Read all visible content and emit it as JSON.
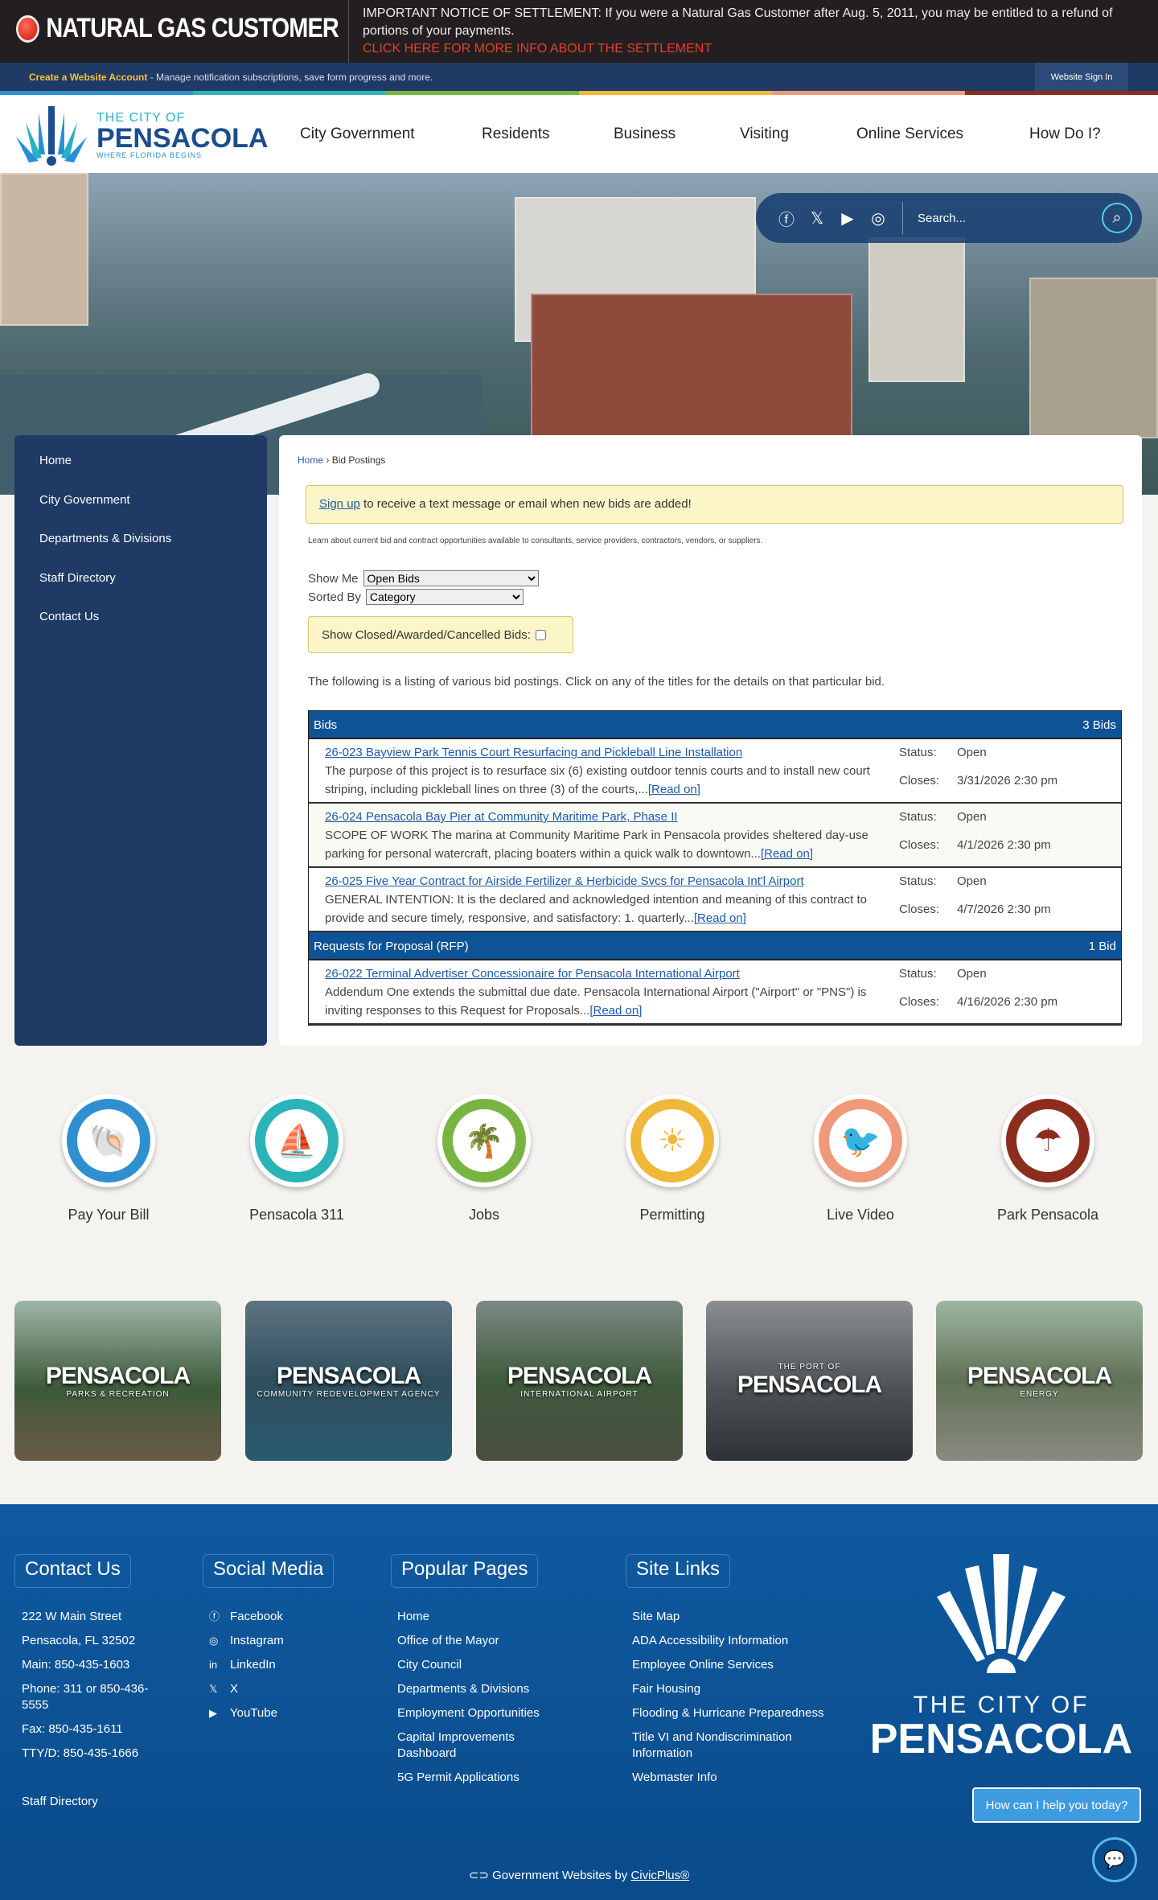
{
  "notice": {
    "title": "NATURAL GAS CUSTOMER",
    "message": "IMPORTANT NOTICE OF SETTLEMENT: If you were a Natural Gas Customer after Aug. 5, 2011, you may be entitled to a refund of portions of your payments.",
    "link": "CLICK HERE FOR MORE INFO ABOUT THE SETTLEMENT"
  },
  "account_bar": {
    "create": "Create a Website Account",
    "text": " - Manage notification subscriptions, save form progress and more.",
    "sign_in": "Website Sign In"
  },
  "stripe_colors": [
    "#2f8fd1",
    "#2ab4b8",
    "#78b442",
    "#f0b83a",
    "#ee9a7a",
    "#8c2d1e"
  ],
  "logo": {
    "line1": "THE CITY OF",
    "line2": "PENSACOLA",
    "tagline": "WHERE FLORIDA BEGINS"
  },
  "nav": [
    "City Government",
    "Residents",
    "Business",
    "Visiting",
    "Online Services",
    "How Do I?"
  ],
  "search": {
    "placeholder": "Search...",
    "social": [
      "facebook-icon",
      "x-icon",
      "youtube-icon",
      "instagram-icon"
    ]
  },
  "sidebar": [
    "Home",
    "City Government",
    "Departments & Divisions",
    "Staff Directory",
    "Contact Us"
  ],
  "breadcrumb": {
    "home": "Home",
    "sep": " › ",
    "current": "Bid Postings"
  },
  "alert": {
    "link": "Sign up",
    "text": " to receive a text message or email when new bids are added!"
  },
  "learn": "Learn about current bid and contract opportunities available to consultants, service providers, contractors, vendors, or suppliers.",
  "filters": {
    "show_label": "Show Me",
    "show_value": "Open Bids",
    "sort_label": "Sorted By",
    "sort_value": "Category",
    "closed_label": "Show Closed/Awarded/Cancelled Bids:"
  },
  "listing": "The following is a listing of various bid postings. Click on any of the titles for the details on that particular bid.",
  "labels": {
    "status": "Status:",
    "closes": "Closes:",
    "read_on": "[Read on]"
  },
  "groups": [
    {
      "name": "Bids",
      "count": "3 Bids",
      "items": [
        {
          "title": "26-023 Bayview Park Tennis Court Resurfacing and Pickleball Line Installation",
          "desc": "The purpose of this project is to resurface six (6) existing outdoor tennis courts and to install new court striping, including pickleball lines on three (3) of the courts,...",
          "status": "Open",
          "closes": "3/31/2026 2:30 pm"
        },
        {
          "title": "26-024 Pensacola Bay Pier at Community Maritime Park, Phase II",
          "desc": "SCOPE OF WORK The marina at Community Maritime Park in Pensacola provides sheltered day-use parking for personal watercraft, placing boaters within a quick walk to downtown...",
          "status": "Open",
          "closes": "4/1/2026 2:30 pm"
        },
        {
          "title": "26-025 Five Year Contract for Airside Fertilizer & Herbicide Svcs for Pensacola Int'l Airport",
          "desc": "GENERAL INTENTION: It is the declared and acknowledged intention and meaning of this contract to provide and secure timely, responsive, and satisfactory: 1. quarterly...",
          "status": "Open",
          "closes": "4/7/2026 2:30 pm"
        }
      ]
    },
    {
      "name": "Requests for Proposal (RFP)",
      "count": "1 Bid",
      "items": [
        {
          "title": "26-022 Terminal Advertiser Concessionaire for Pensacola International Airport",
          "desc": "Addendum One extends the submittal due date. Pensacola International Airport (\"Airport\" or \"PNS\") is inviting responses to this Request for Proposals...",
          "status": "Open",
          "closes": "4/16/2026 2:30 pm"
        }
      ]
    }
  ],
  "quick_links": [
    {
      "label": "Pay Your Bill",
      "icon": "shell-icon",
      "glyph": "🐚",
      "color": "#2f8fd1"
    },
    {
      "label": "Pensacola 311",
      "icon": "sailboat-icon",
      "glyph": "⛵",
      "color": "#2ab4b8"
    },
    {
      "label": "Jobs",
      "icon": "palm-tree-icon",
      "glyph": "🌴",
      "color": "#78b442"
    },
    {
      "label": "Permitting",
      "icon": "sun-icon",
      "glyph": "☀",
      "color": "#f0b83a"
    },
    {
      "label": "Live Video",
      "icon": "pelican-icon",
      "glyph": "🐦",
      "color": "#ee9a7a"
    },
    {
      "label": "Park Pensacola",
      "icon": "umbrella-icon",
      "glyph": "☂",
      "color": "#8c2d1e"
    }
  ],
  "tiles": [
    {
      "name": "PENSACOLA",
      "sub": "PARKS & RECREATION"
    },
    {
      "name": "PENSACOLA",
      "sub": "COMMUNITY REDEVELOPMENT AGENCY"
    },
    {
      "name": "PENSACOLA",
      "sub": "INTERNATIONAL AIRPORT"
    },
    {
      "name": "PENSACOLA",
      "sub": "THE PORT OF"
    },
    {
      "name": "PENSACOLA",
      "sub": "ENERGY"
    }
  ],
  "footer": {
    "contact": {
      "title": "Contact Us",
      "lines": [
        "222 W Main Street",
        "Pensacola, FL 32502",
        "Main: 850-435-1603",
        "Phone: 311 or 850-436-5555",
        "Fax: 850-435-1611",
        "TTY/D: 850-435-1666"
      ],
      "staff": "Staff Directory"
    },
    "social": {
      "title": "Social Media",
      "items": [
        "Facebook",
        "Instagram",
        "LinkedIn",
        "X",
        "YouTube"
      ]
    },
    "popular": {
      "title": "Popular Pages",
      "items": [
        "Home",
        "Office of the Mayor",
        "City Council",
        "Departments & Divisions",
        "Employment Opportunities",
        "Capital Improvements Dashboard",
        "5G Permit Applications"
      ]
    },
    "site": {
      "title": "Site Links",
      "items": [
        "Site Map",
        "ADA Accessibility Information",
        "Employee Online Services",
        "Fair Housing",
        "Flooding & Hurricane Preparedness",
        "Title VI and Nondiscrimination Information",
        "Webmaster Info"
      ]
    },
    "logo": {
      "line1": "THE CITY OF",
      "line2": "PENSACOLA"
    },
    "chat": "How can I help you today?",
    "credit": "Government Websites by ",
    "credit_link": "CivicPlus®"
  }
}
